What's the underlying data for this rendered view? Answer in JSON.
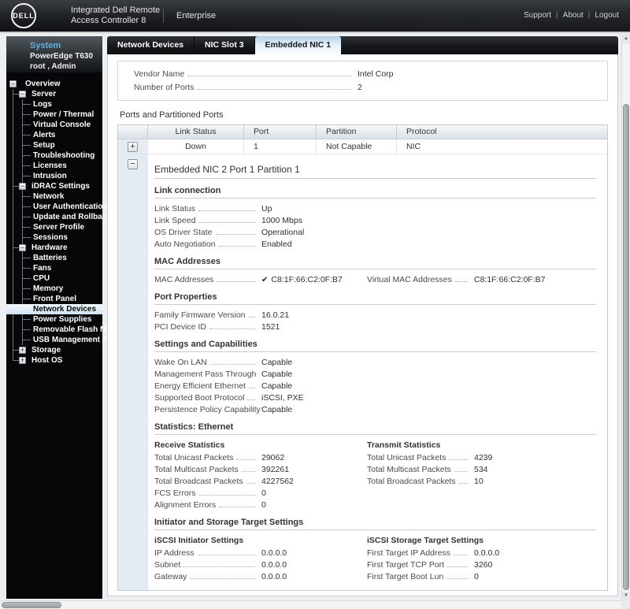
{
  "header": {
    "logo": "DELL",
    "title_line1": "Integrated Dell Remote",
    "title_line2": "Access Controller 8",
    "edition": "Enterprise",
    "links": [
      "Support",
      "About",
      "Logout"
    ]
  },
  "sidebar": {
    "system_label": "System",
    "model": "PowerEdge T630",
    "user": "root , Admin",
    "tree": [
      {
        "label": "Overview",
        "level": 0,
        "expander": "minus"
      },
      {
        "label": "Server",
        "level": 1,
        "expander": "minus"
      },
      {
        "label": "Logs",
        "level": 2
      },
      {
        "label": "Power / Thermal",
        "level": 2
      },
      {
        "label": "Virtual Console",
        "level": 2
      },
      {
        "label": "Alerts",
        "level": 2
      },
      {
        "label": "Setup",
        "level": 2
      },
      {
        "label": "Troubleshooting",
        "level": 2
      },
      {
        "label": "Licenses",
        "level": 2
      },
      {
        "label": "Intrusion",
        "level": 2
      },
      {
        "label": "iDRAC Settings",
        "level": 1,
        "expander": "minus"
      },
      {
        "label": "Network",
        "level": 2
      },
      {
        "label": "User Authentication",
        "level": 2
      },
      {
        "label": "Update and Rollback",
        "level": 2
      },
      {
        "label": "Server Profile",
        "level": 2
      },
      {
        "label": "Sessions",
        "level": 2
      },
      {
        "label": "Hardware",
        "level": 1,
        "expander": "minus"
      },
      {
        "label": "Batteries",
        "level": 2
      },
      {
        "label": "Fans",
        "level": 2
      },
      {
        "label": "CPU",
        "level": 2
      },
      {
        "label": "Memory",
        "level": 2
      },
      {
        "label": "Front Panel",
        "level": 2
      },
      {
        "label": "Network Devices",
        "level": 2,
        "selected": true
      },
      {
        "label": "Power Supplies",
        "level": 2
      },
      {
        "label": "Removable Flash Media",
        "level": 2
      },
      {
        "label": "USB Management Port",
        "level": 2
      },
      {
        "label": "Storage",
        "level": 1,
        "expander": "plus"
      },
      {
        "label": "Host OS",
        "level": 1,
        "expander": "plus"
      }
    ]
  },
  "tabs": [
    {
      "label": "Network Devices"
    },
    {
      "label": "NIC Slot 3"
    },
    {
      "label": "Embedded NIC 1",
      "active": true
    }
  ],
  "summary": {
    "rows": [
      {
        "label": "Vendor Name",
        "value": "Intel Corp"
      },
      {
        "label": "Number of Ports",
        "value": "2"
      }
    ]
  },
  "ports": {
    "title": "Ports and Partitioned Ports",
    "columns": [
      "Link Status",
      "Port",
      "Partition",
      "Protocol"
    ],
    "collapsed_row": {
      "link_status": "Down",
      "port": "1",
      "partition": "Not Capable",
      "protocol": "NIC"
    }
  },
  "expanded": {
    "title": "Embedded NIC 2 Port 1 Partition 1",
    "sections": [
      {
        "heading": "Link connection",
        "rows": [
          {
            "label": "Link Status",
            "value": "Up"
          },
          {
            "label": "Link Speed",
            "value": "1000 Mbps"
          },
          {
            "label": "OS Driver State",
            "value": "Operational"
          },
          {
            "label": "Auto Negotiation",
            "value": "Enabled"
          }
        ]
      },
      {
        "heading": "MAC Addresses",
        "columns": [
          {
            "rows": [
              {
                "label": "MAC Addresses",
                "value": "C8:1F:66:C2:0F:B7",
                "check": true
              }
            ]
          },
          {
            "rows": [
              {
                "label": "Virtual MAC Addresses",
                "value": "C8:1F:66:C2:0F:B7"
              }
            ]
          }
        ]
      },
      {
        "heading": "Port Properties",
        "rows": [
          {
            "label": "Family Firmware Version",
            "value": "16.0.21"
          },
          {
            "label": "PCI Device ID",
            "value": "1521"
          }
        ]
      },
      {
        "heading": "Settings and Capabilities",
        "rows": [
          {
            "label": "Wake On LAN",
            "value": "Capable"
          },
          {
            "label": "Management Pass Through",
            "value": "Capable"
          },
          {
            "label": "Energy Efficient Ethernet",
            "value": "Capable"
          },
          {
            "label": "Supported Boot Protocol",
            "value": "iSCSI, PXE"
          },
          {
            "label": "Persistence Policy Capability",
            "value": "Capable"
          }
        ]
      },
      {
        "heading": "Statistics: Ethernet",
        "columns": [
          {
            "subheading": "Receive Statistics",
            "rows": [
              {
                "label": "Total Unicast Packets",
                "value": "29062"
              },
              {
                "label": "Total Multicast Packets",
                "value": "392261"
              },
              {
                "label": "Total Broadcast Packets",
                "value": "4227562"
              },
              {
                "label": "FCS Errors",
                "value": "0"
              },
              {
                "label": "Alignment Errors",
                "value": "0"
              }
            ]
          },
          {
            "subheading": "Transmit Statistics",
            "rows": [
              {
                "label": "Total Unicast Packets",
                "value": "4239"
              },
              {
                "label": "Total Multicast Packets",
                "value": "534"
              },
              {
                "label": "Total Broadcast Packets",
                "value": "10"
              }
            ]
          }
        ]
      },
      {
        "heading": "Initiator and Storage Target Settings",
        "columns": [
          {
            "subheading": "iSCSI Initiator Settings",
            "rows": [
              {
                "label": "IP Address",
                "value": "0.0.0.0"
              },
              {
                "label": "Subnet",
                "value": "0.0.0.0"
              },
              {
                "label": "Gateway",
                "value": "0.0.0.0"
              }
            ]
          },
          {
            "subheading": "iSCSI Storage Target Settings",
            "rows": [
              {
                "label": "First Target IP Address",
                "value": "0.0.0.0"
              },
              {
                "label": "First Target TCP Port",
                "value": "3260"
              },
              {
                "label": "First Target Boot Lun",
                "value": "0"
              }
            ]
          }
        ]
      }
    ]
  }
}
